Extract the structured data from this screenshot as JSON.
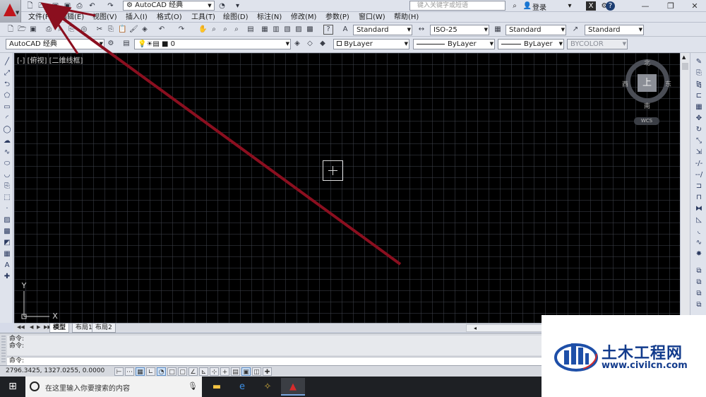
{
  "quick_access": {
    "workspace": "AutoCAD 经典",
    "search_placeholder": "键入关键字或短语",
    "login": "登录"
  },
  "menu": [
    "文件(F)",
    "编辑(E)",
    "视图(V)",
    "插入(I)",
    "格式(O)",
    "工具(T)",
    "绘图(D)",
    "标注(N)",
    "修改(M)",
    "参数(P)",
    "窗口(W)",
    "帮助(H)"
  ],
  "styles_toolbar": {
    "text_style": "Standard",
    "dim_style": "ISO-25",
    "table_style": "Standard",
    "multileader_style": "Standard"
  },
  "layers_toolbar": {
    "workspace": "AutoCAD 经典",
    "layer": "0",
    "color": "ByLayer",
    "linetype": "ByLayer",
    "lineweight": "ByLayer",
    "plotstyle": "BYCOLOR"
  },
  "viewport": {
    "label": "[-] [俯视] [二维线框]",
    "viewcube_face": "上",
    "north": "北",
    "south": "南",
    "east": "东",
    "west": "西",
    "wcs": "WCS",
    "ucs_x": "X",
    "ucs_y": "Y"
  },
  "layout_tabs": [
    "模型",
    "布局1",
    "布局2"
  ],
  "command": {
    "history": [
      "命令:",
      "命令:"
    ],
    "prompt": "命令:"
  },
  "status": {
    "coords": "2796.3425, 1327.0255, 0.0000"
  },
  "taskbar": {
    "search_text": "在这里输入你要搜索的内容"
  },
  "watermark": {
    "title": "土木工程网",
    "url": "www.civilcn.com"
  },
  "colors": {
    "annotation": "#8b0f1f",
    "canvas": "#000000",
    "brand": "#123b8c"
  }
}
